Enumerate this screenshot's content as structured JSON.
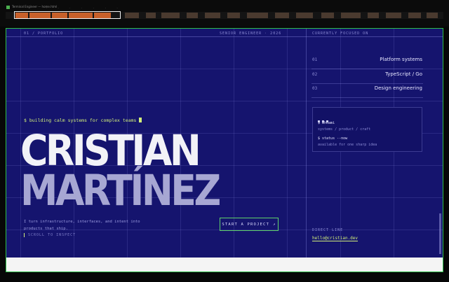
{
  "window": {
    "title": "Terminal Engineer — home.html"
  },
  "page": {
    "meta_left": "01 / PORTFOLIO",
    "meta_center": "SENIOR ENGINEER · 2026",
    "meta_right": "CURRENTLY FOCUSED ON",
    "prompt": "$ building calm systems for complex teams",
    "name_first": "CRISTIAN",
    "name_last": "MARTÍNEZ",
    "intro": "I turn infrastructure, interfaces, and intent into products that ship.",
    "scroll_hint": "SCROLL TO INSPECT",
    "cta_label": "START A PROJECT",
    "cta_arrow": "↗",
    "focus": [
      {
        "idx": "01",
        "label": "Platform systems"
      },
      {
        "idx": "02",
        "label": "TypeScript / Go"
      },
      {
        "idx": "03",
        "label": "Design engineering"
      }
    ],
    "terminal": {
      "cmd1": "$ whoami",
      "out1": "systems / product / craft",
      "cmd2": "$ status --now",
      "out2": "available for one sharp idea"
    },
    "direct_line_label": "DIRECT LINE",
    "email": "hello@cristian.dev"
  },
  "colors": {
    "background": "#15146e",
    "accent": "#d3f07a",
    "frame": "#2fbf4a"
  }
}
